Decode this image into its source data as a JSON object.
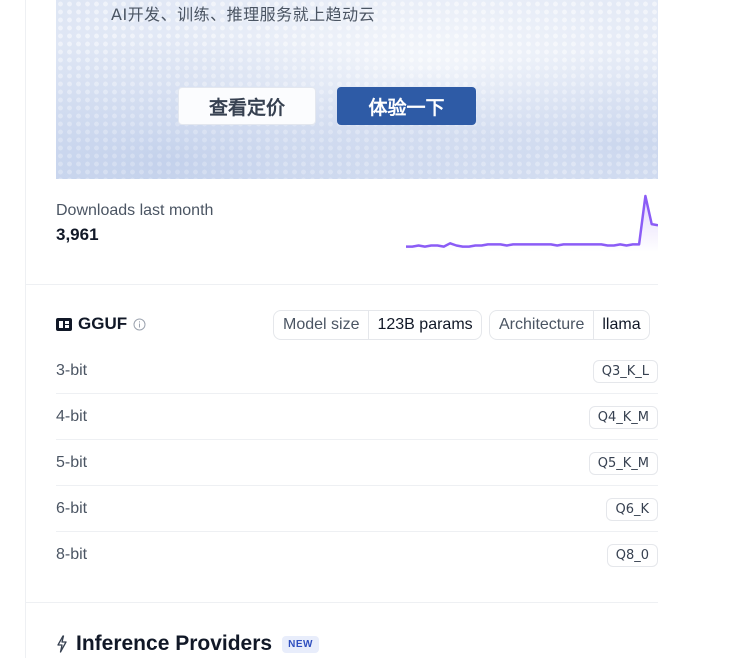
{
  "banner": {
    "subtitle": "AI开发、训练、推理服务就上趋动云",
    "pricing_button": "查看定价",
    "try_button": "体验一下"
  },
  "downloads": {
    "label": "Downloads last month",
    "count": "3,961"
  },
  "chart_data": {
    "type": "line",
    "values": [
      3,
      3,
      4,
      3,
      4,
      4,
      3,
      6,
      4,
      3,
      3,
      4,
      4,
      5,
      5,
      5,
      4,
      5,
      5,
      5,
      5,
      5,
      5,
      5,
      4,
      5,
      5,
      5,
      5,
      5,
      5,
      5,
      4,
      4,
      5,
      4,
      5,
      5,
      48,
      23,
      22
    ],
    "color": "#8b5cf6",
    "title": "",
    "xlabel": "",
    "ylabel": ""
  },
  "gguf": {
    "title": "GGUF",
    "model_size_label": "Model size",
    "model_size_value": "123B params",
    "architecture_label": "Architecture",
    "architecture_value": "llama",
    "quants": [
      {
        "bits": "3-bit",
        "name": "Q3_K_L"
      },
      {
        "bits": "4-bit",
        "name": "Q4_K_M"
      },
      {
        "bits": "5-bit",
        "name": "Q5_K_M"
      },
      {
        "bits": "6-bit",
        "name": "Q6_K"
      },
      {
        "bits": "8-bit",
        "name": "Q8_0"
      }
    ]
  },
  "inference": {
    "title": "Inference Providers",
    "badge": "NEW"
  },
  "icons": {
    "gguf": "gguf-logo-icon",
    "info": "info-icon",
    "inference": "lightning-icon"
  }
}
